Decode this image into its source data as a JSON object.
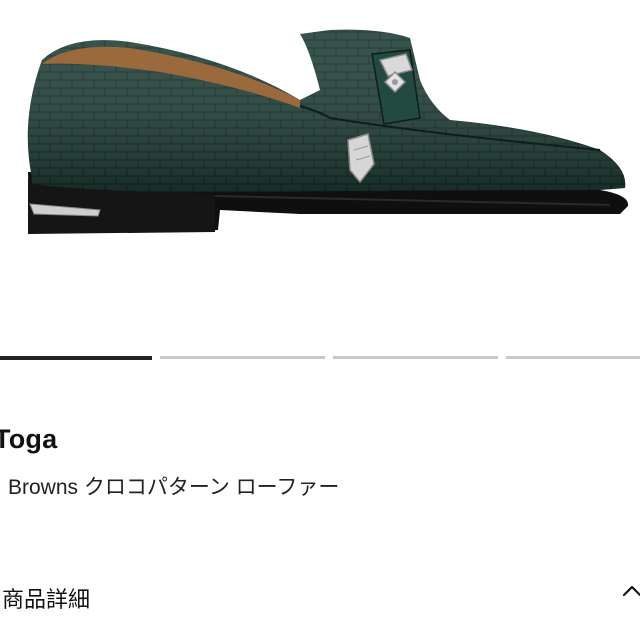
{
  "product": {
    "brand": "Toga",
    "title": "Browns クロコパターン ローファー",
    "image_alt": "green croc-embossed loafer with silver hardware"
  },
  "gallery": {
    "slide_count": 4,
    "active_index": 0
  },
  "details": {
    "label": "商品詳細",
    "chevron_icon": "chevron-up-icon"
  },
  "colors": {
    "shoe": "#1f3f37",
    "sole": "#0f0f0f",
    "hardware": "#cfcfcf",
    "indicator_active": "#222222",
    "indicator_inactive": "#c9c9c9"
  }
}
